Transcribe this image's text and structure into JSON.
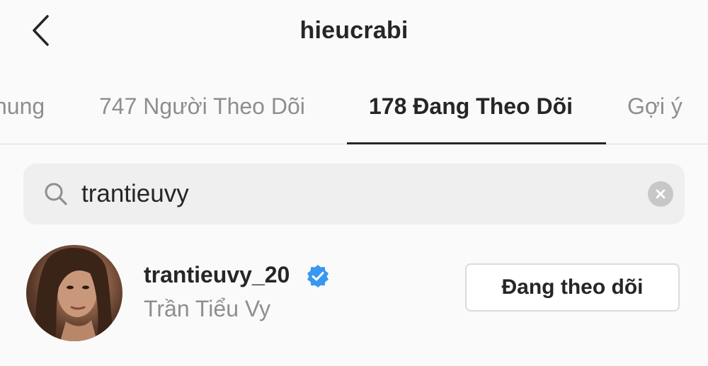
{
  "header": {
    "title": "hieucrabi",
    "back_icon": "chevron-left-icon"
  },
  "tabs": [
    {
      "label": "hung",
      "active": false
    },
    {
      "label": "747 Người Theo Dõi",
      "active": false
    },
    {
      "label": "178 Đang Theo Dõi",
      "active": true
    },
    {
      "label": "Gợi ý",
      "active": false
    }
  ],
  "search": {
    "value": "trantieuvy",
    "icon": "search-icon",
    "clear_icon": "clear-icon"
  },
  "results": [
    {
      "username": "trantieuvy_20",
      "verified": true,
      "full_name": "Trần Tiểu Vy",
      "button_label": "Đang theo dõi"
    }
  ],
  "colors": {
    "background": "#fafafa",
    "primary_text": "#262626",
    "secondary_text": "#8e8e8e",
    "verified_badge": "#3897f0",
    "search_bg": "#efefef"
  }
}
